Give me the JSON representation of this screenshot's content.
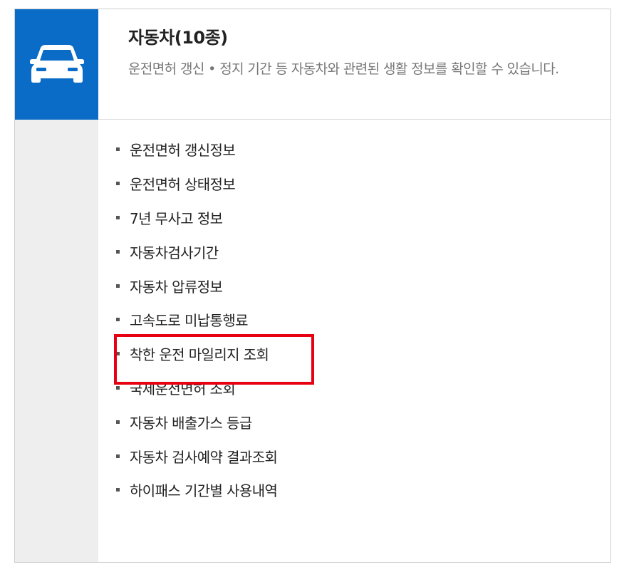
{
  "category": {
    "icon": "car-icon",
    "accent_color": "#0a6cc6",
    "highlight_color": "#e60012",
    "title": "자동차(10종)",
    "description": "운전면허 갱신 • 정지 기간 등 자동차와 관련된 생활 정보를 확인할 수 있습니다."
  },
  "items": [
    {
      "label": "운전면허 갱신정보"
    },
    {
      "label": "운전면허 상태정보"
    },
    {
      "label": "7년 무사고 정보"
    },
    {
      "label": "자동차검사기간"
    },
    {
      "label": "자동차 압류정보"
    },
    {
      "label": "고속도로 미납통행료"
    },
    {
      "label": "착한 운전 마일리지 조회"
    },
    {
      "label": "국제운전면허 조회"
    },
    {
      "label": "자동차 배출가스 등급"
    },
    {
      "label": "자동차 검사예약 결과조회"
    },
    {
      "label": "하이패스 기간별 사용내역"
    }
  ]
}
